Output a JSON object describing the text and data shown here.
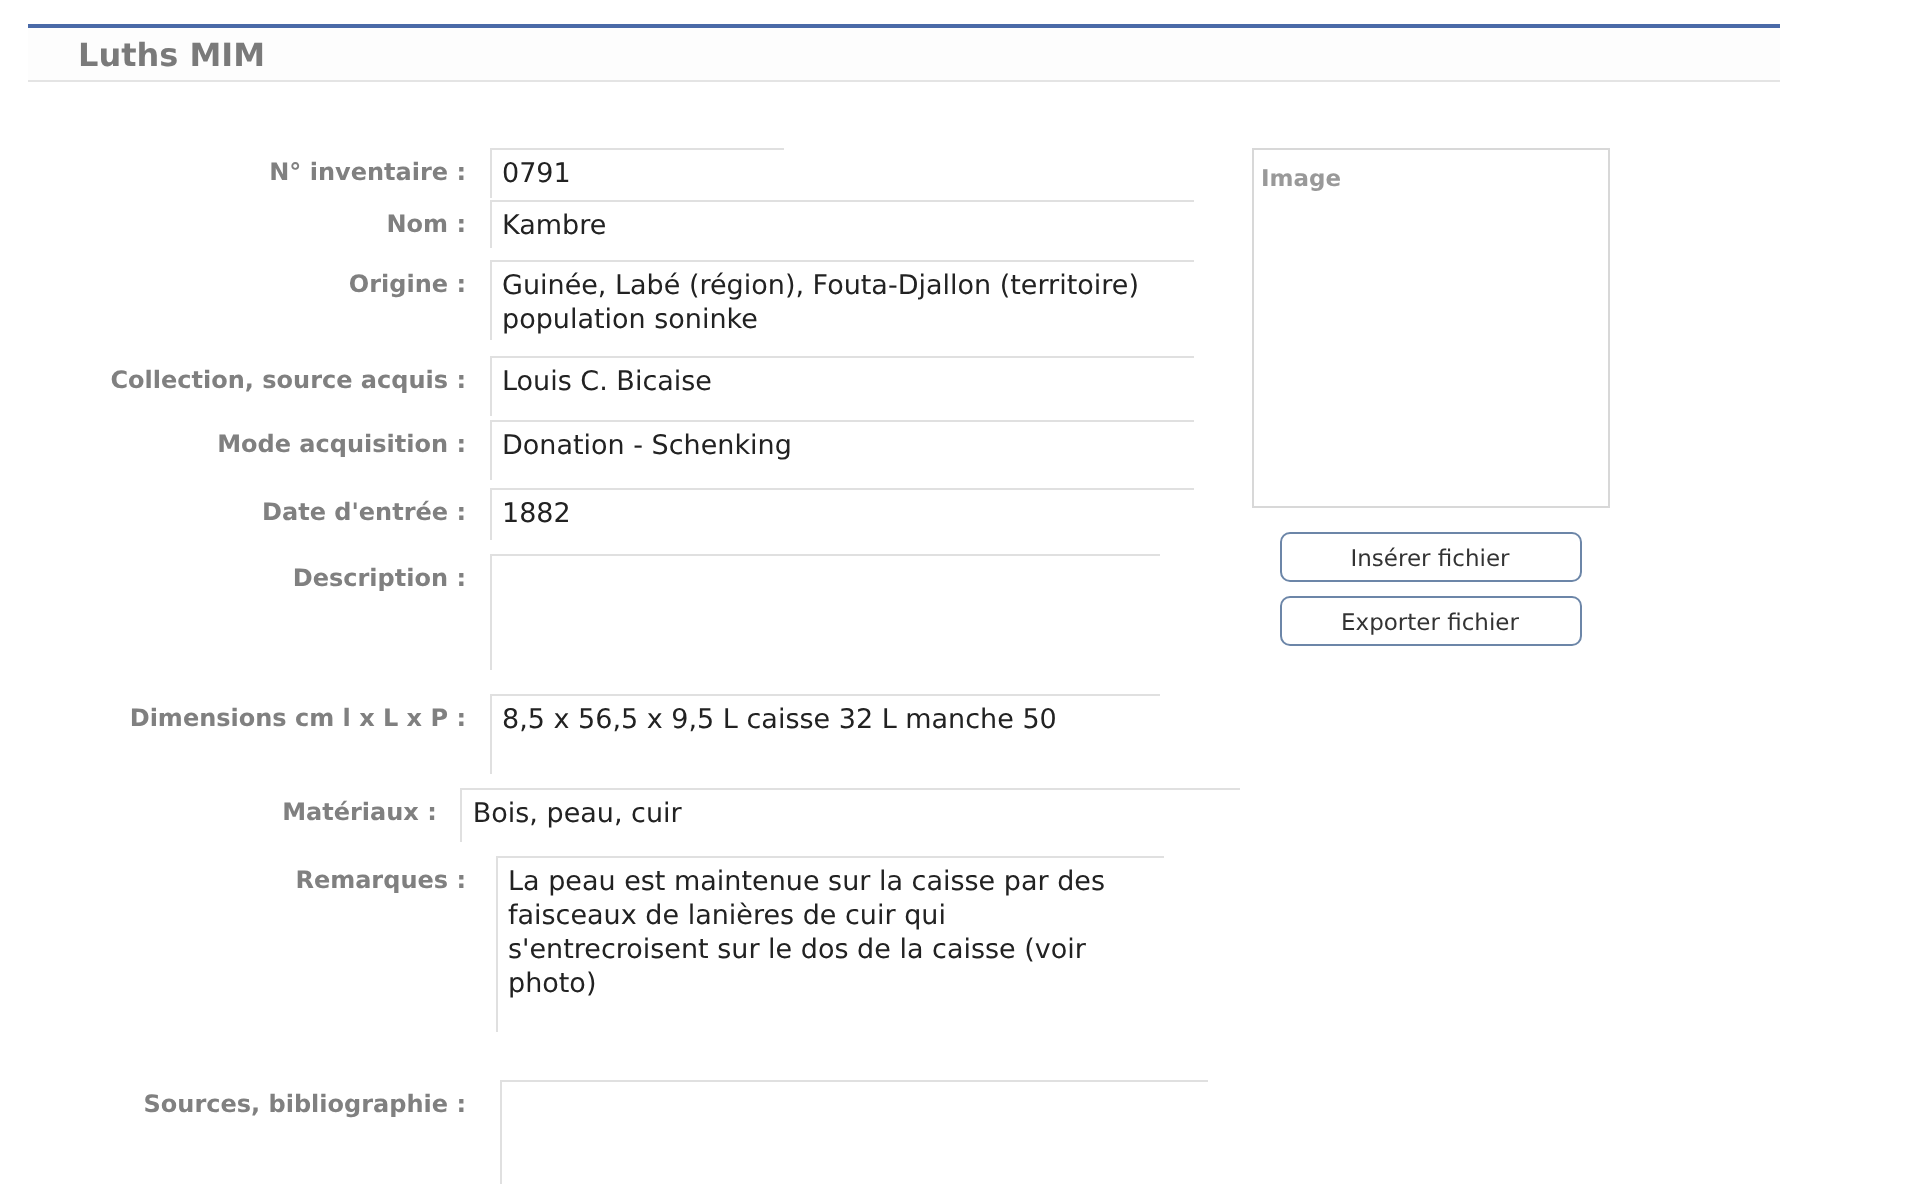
{
  "header": {
    "title": "Luths MIM"
  },
  "fields": [
    {
      "label": "N° inventaire :",
      "value": "0791"
    },
    {
      "label": "Nom :",
      "value": "Kambre"
    },
    {
      "label": "Origine :",
      "value": "Guinée, Labé (région), Fouta-Djallon (territoire) population soninke"
    },
    {
      "label": "Collection, source acquis :",
      "value": "Louis C. Bicaise"
    },
    {
      "label": "Mode acquisition :",
      "value": "Donation - Schenking"
    },
    {
      "label": "Date d'entrée :",
      "value": "1882"
    },
    {
      "label": "Description :"
    },
    {
      "label": "Dimensions cm l x L x P :",
      "value": "8,5 x 56,5 x 9,5    L caisse 32 L manche 50"
    },
    {
      "label": "Matériaux :",
      "value": "Bois, peau, cuir"
    },
    {
      "label": "Remarques :",
      "value": "La peau est maintenue sur la caisse par des faisceaux de lanières de cuir qui s'entrecroisent sur le dos de la caisse (voir photo)"
    },
    {
      "label": "Sources, bibliographie :"
    }
  ],
  "image_panel": {
    "label": "Image",
    "buttons": [
      "Insérer fichier",
      "Exporter fichier"
    ]
  }
}
